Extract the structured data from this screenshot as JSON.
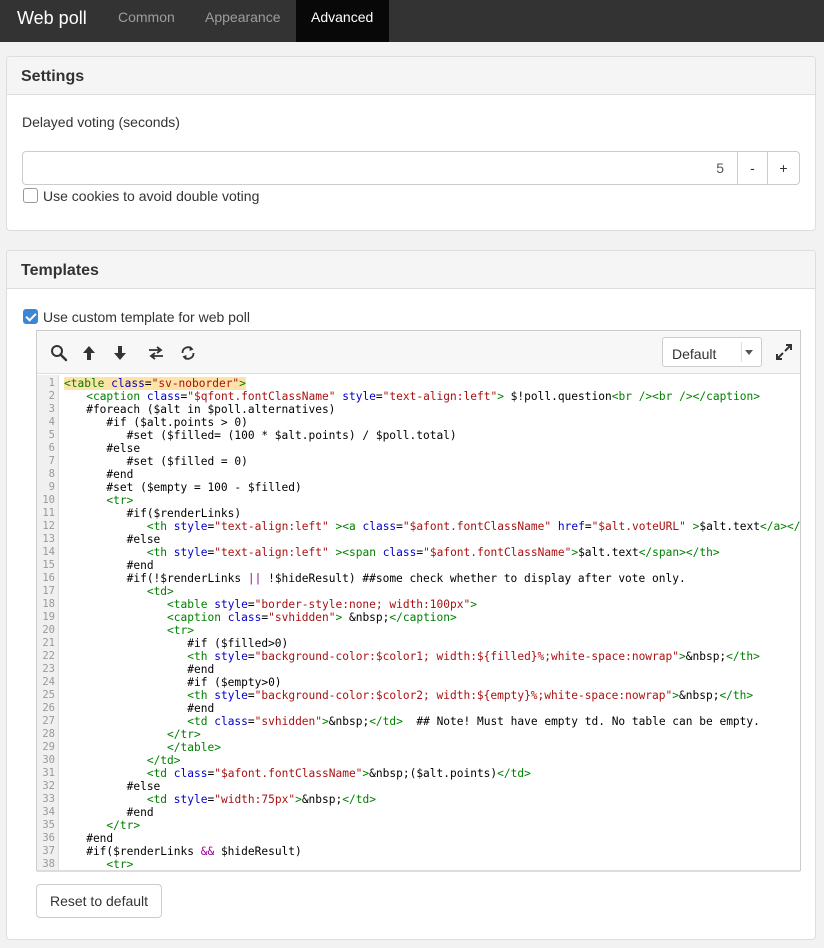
{
  "nav": {
    "brand": "Web poll",
    "tabs": [
      {
        "label": "Common",
        "active": false
      },
      {
        "label": "Appearance",
        "active": false
      },
      {
        "label": "Advanced",
        "active": true
      }
    ]
  },
  "settings": {
    "title": "Settings",
    "delay_label": "Delayed voting (seconds)",
    "delay_value": "5",
    "minus_label": "-",
    "plus_label": "+",
    "cookies_label": "Use cookies to avoid double voting",
    "cookies_checked": false
  },
  "templates": {
    "title": "Templates",
    "custom_label": "Use custom template for web poll",
    "custom_checked": true,
    "theme_select": "Default",
    "reset_label": "Reset to default",
    "code_lines": [
      "<table class=\"sv-noborder\">",
      "   <caption class=\"$qfont.fontClassName\" style=\"text-align:left\"> $!poll.question<br /><br /></caption>",
      "   #foreach ($alt in $poll.alternatives)",
      "      #if ($alt.points > 0)",
      "         #set ($filled= (100 * $alt.points) / $poll.total)",
      "      #else",
      "         #set ($filled = 0)",
      "      #end",
      "      #set ($empty = 100 - $filled)",
      "      <tr>",
      "         #if($renderLinks)",
      "            <th style=\"text-align:left\" ><a class=\"$afont.fontClassName\" href=\"$alt.voteURL\" >$alt.text</a></th>",
      "         #else",
      "            <th style=\"text-align:left\" ><span class=\"$afont.fontClassName\">$alt.text</span></th>",
      "         #end",
      "         #if(!$renderLinks || !$hideResult) ##some check whether to display after vote only.",
      "            <td>",
      "               <table style=\"border-style:none; width:100px\">",
      "               <caption class=\"svhidden\"> &nbsp;</caption>",
      "               <tr>",
      "                  #if ($filled>0)",
      "                  <th style=\"background-color:$color1; width:${filled}%;white-space:nowrap\">&nbsp;</th>",
      "                  #end",
      "                  #if ($empty>0)",
      "                  <th style=\"background-color:$color2; width:${empty}%;white-space:nowrap\">&nbsp;</th>",
      "                  #end",
      "                  <td class=\"svhidden\">&nbsp;</td>  ## Note! Must have empty td. No table can be empty.",
      "               </tr>",
      "               </table>",
      "            </td>",
      "            <td class=\"$afont.fontClassName\">&nbsp;($alt.points)</td>",
      "         #else",
      "            <td style=\"width:75px\">&nbsp;</td>",
      "         #end",
      "      </tr>",
      "   #end",
      "   #if($renderLinks && $hideResult)",
      "      <tr>"
    ]
  },
  "colors": {
    "tag": "#008000",
    "attr": "#0000cc",
    "string": "#aa1111",
    "op": "#990099",
    "highlight": "#fde3a7"
  }
}
